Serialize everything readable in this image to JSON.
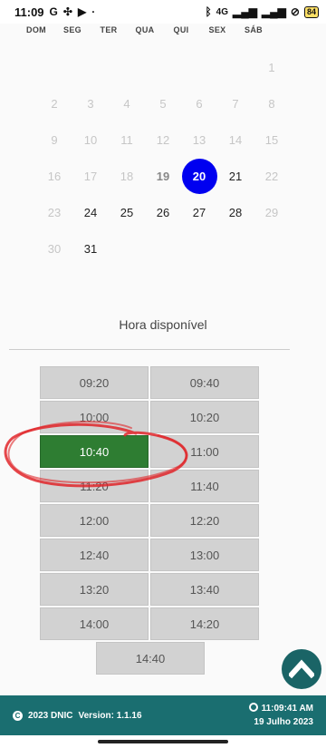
{
  "status_bar": {
    "time": "11:09",
    "left_icons": [
      "google-icon",
      "fan-icon",
      "youtube-icon",
      "dot-icon"
    ],
    "network": "4G",
    "battery": "84"
  },
  "calendar": {
    "weekdays": [
      "DOM",
      "SEG",
      "TER",
      "QUA",
      "QUI",
      "SEX",
      "SÁB"
    ],
    "weeks": [
      [
        "",
        "",
        "",
        "",
        "",
        "",
        "1"
      ],
      [
        "2",
        "3",
        "4",
        "5",
        "6",
        "7",
        "8"
      ],
      [
        "9",
        "10",
        "11",
        "12",
        "13",
        "14",
        "15"
      ],
      [
        "16",
        "17",
        "18",
        "19",
        "20",
        "21",
        "22"
      ],
      [
        "23",
        "24",
        "25",
        "26",
        "27",
        "28",
        "29"
      ],
      [
        "30",
        "31",
        "",
        "",
        "",
        "",
        ""
      ]
    ],
    "selected_day": "20",
    "selected_color": "#0000f0"
  },
  "hora": {
    "title": "Hora disponível",
    "slots": [
      "09:20",
      "09:40",
      "10:00",
      "10:20",
      "10:40",
      "11:00",
      "11:20",
      "11:40",
      "12:00",
      "12:20",
      "12:40",
      "13:00",
      "13:20",
      "13:40",
      "14:00",
      "14:20",
      "14:40"
    ],
    "selected_slot": "10:40",
    "selected_color": "#2e7d32"
  },
  "scroll_top_button": {
    "icon": "chevron-up-icon"
  },
  "footer": {
    "copyright": "2023 DNIC",
    "version_label": "Version: 1.1.16",
    "clock_time": "11:09:41 AM",
    "date": "19 Julho 2023"
  }
}
